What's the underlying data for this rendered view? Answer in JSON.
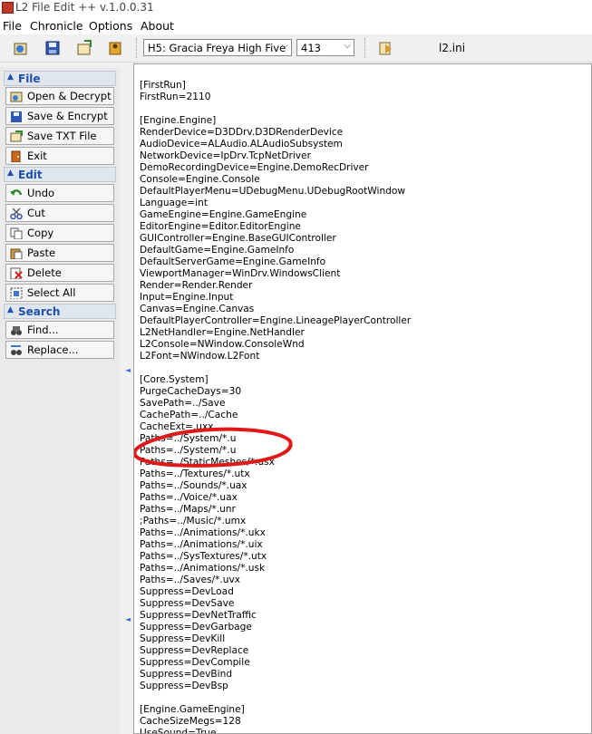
{
  "window": {
    "title": "L2 File Edit ++ v.1.0.0.31"
  },
  "menu": [
    "File",
    "Chronicle",
    "Options",
    "About"
  ],
  "toolbar": {
    "chronicle_value": "H5: Gracia Freya High Five",
    "protocol_value": "413",
    "filename": "l2.ini"
  },
  "sidebar": {
    "file": {
      "title": "File",
      "items": [
        "Open & Decrypt",
        "Save & Encrypt",
        "Save TXT File",
        "Exit"
      ]
    },
    "edit": {
      "title": "Edit",
      "items": [
        "Undo",
        "Cut",
        "Copy",
        "Paste",
        "Delete",
        "Select All"
      ]
    },
    "search": {
      "title": "Search",
      "items": [
        "Find...",
        "Replace..."
      ]
    }
  },
  "editor_lines": [
    "[FirstRun]",
    "FirstRun=2110",
    "",
    "[Engine.Engine]",
    "RenderDevice=D3DDrv.D3DRenderDevice",
    "AudioDevice=ALAudio.ALAudioSubsystem",
    "NetworkDevice=IpDrv.TcpNetDriver",
    "DemoRecordingDevice=Engine.DemoRecDriver",
    "Console=Engine.Console",
    "DefaultPlayerMenu=UDebugMenu.UDebugRootWindow",
    "Language=int",
    "GameEngine=Engine.GameEngine",
    "EditorEngine=Editor.EditorEngine",
    "GUIController=Engine.BaseGUIController",
    "DefaultGame=Engine.GameInfo",
    "DefaultServerGame=Engine.GameInfo",
    "ViewportManager=WinDrv.WindowsClient",
    "Render=Render.Render",
    "Input=Engine.Input",
    "Canvas=Engine.Canvas",
    "DefaultPlayerController=Engine.LineagePlayerController",
    "L2NetHandler=Engine.NetHandler",
    "L2Console=NWindow.ConsoleWnd",
    "L2Font=NWindow.L2Font",
    "",
    "[Core.System]",
    "PurgeCacheDays=30",
    "SavePath=../Save",
    "CachePath=../Cache",
    "CacheExt=.uxx",
    "Paths=../System/*.u",
    "Paths=../System/*.u",
    "Paths=../StaticMeshes/*.usx",
    "Paths=../Textures/*.utx",
    "Paths=../Sounds/*.uax",
    "Paths=../Voice/*.uax",
    "Paths=../Maps/*.unr",
    ";Paths=../Music/*.umx",
    "Paths=../Animations/*.ukx",
    "Paths=../Animations/*.uix",
    "Paths=../SysTextures/*.utx",
    "Paths=../Animations/*.usk",
    "Paths=../Saves/*.uvx",
    "Suppress=DevLoad",
    "Suppress=DevSave",
    "Suppress=DevNetTraffic",
    "Suppress=DevGarbage",
    "Suppress=DevKill",
    "Suppress=DevReplace",
    "Suppress=DevCompile",
    "Suppress=DevBind",
    "Suppress=DevBsp",
    "",
    "[Engine.GameEngine]",
    "CacheSizeMegs=128",
    "UseSound=True"
  ],
  "colors": {
    "annotation": "#e01818",
    "section_text": "#1f4fae"
  }
}
